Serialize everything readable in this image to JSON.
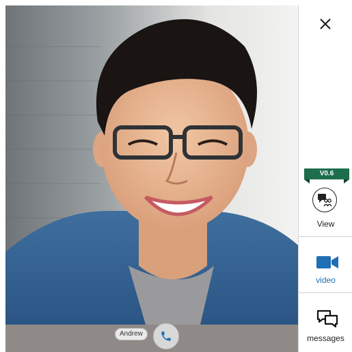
{
  "call": {
    "participant_name": "Andrew"
  },
  "sidebar": {
    "version": "V0.6",
    "view_label": "View",
    "video_label": "video",
    "messages_label": "messages"
  },
  "colors": {
    "accent_blue": "#1f6fb5",
    "ribbon_green": "#1e6e4e",
    "bar_gray": "#8f8a88"
  },
  "icons": {
    "close": "close-icon",
    "view": "participants-view-icon",
    "video": "video-camera-icon",
    "messages": "chat-bubbles-icon",
    "call": "phone-icon"
  }
}
